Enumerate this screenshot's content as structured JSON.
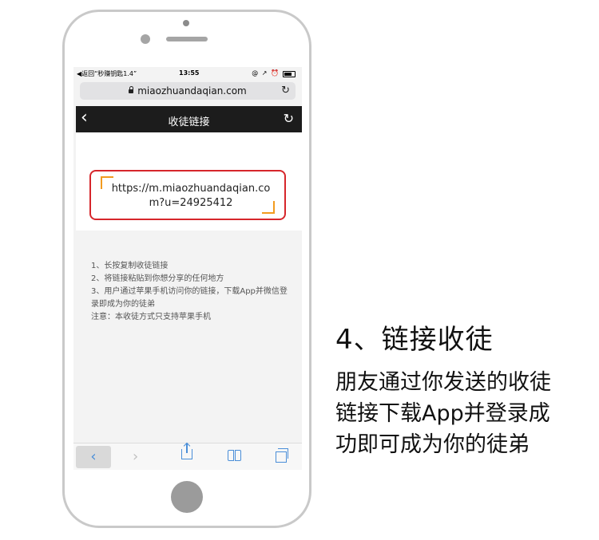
{
  "statusbar": {
    "back_app": "◀返回“秒赚钥匙1.4”",
    "time": "13:55",
    "icons": "@ ↗ ⏰"
  },
  "browser": {
    "url": "miaozhuandaqian.com",
    "reload_icon": "reload-icon"
  },
  "navbar": {
    "back_glyph": "‹",
    "title": "收徒链接",
    "refresh_glyph": "↻"
  },
  "link_box": {
    "url": "https://m.miaozhuandaqian.com?u=24925412"
  },
  "instructions": [
    "1、长按复制收徒链接",
    "2、将链接粘贴到你想分享的任何地方",
    "3、用户通过苹果手机访问你的链接，下载App并微信登录即成为你的徒弟",
    "注意：本收徒方式只支持苹果手机"
  ],
  "toolbar": {
    "back_glyph": "‹",
    "forward_glyph": "›"
  },
  "step": {
    "title": "4、链接收徒",
    "desc_lines": [
      "朋友通过你发送的收徒",
      "链接下载App并登录成",
      "功即可成为你的徒弟"
    ]
  },
  "colors": {
    "highlight_border": "#d6262b",
    "corner_accent": "#f29b1f",
    "navbar_bg": "#1c1c1c",
    "toolbar_icon": "#4a8ed8"
  }
}
